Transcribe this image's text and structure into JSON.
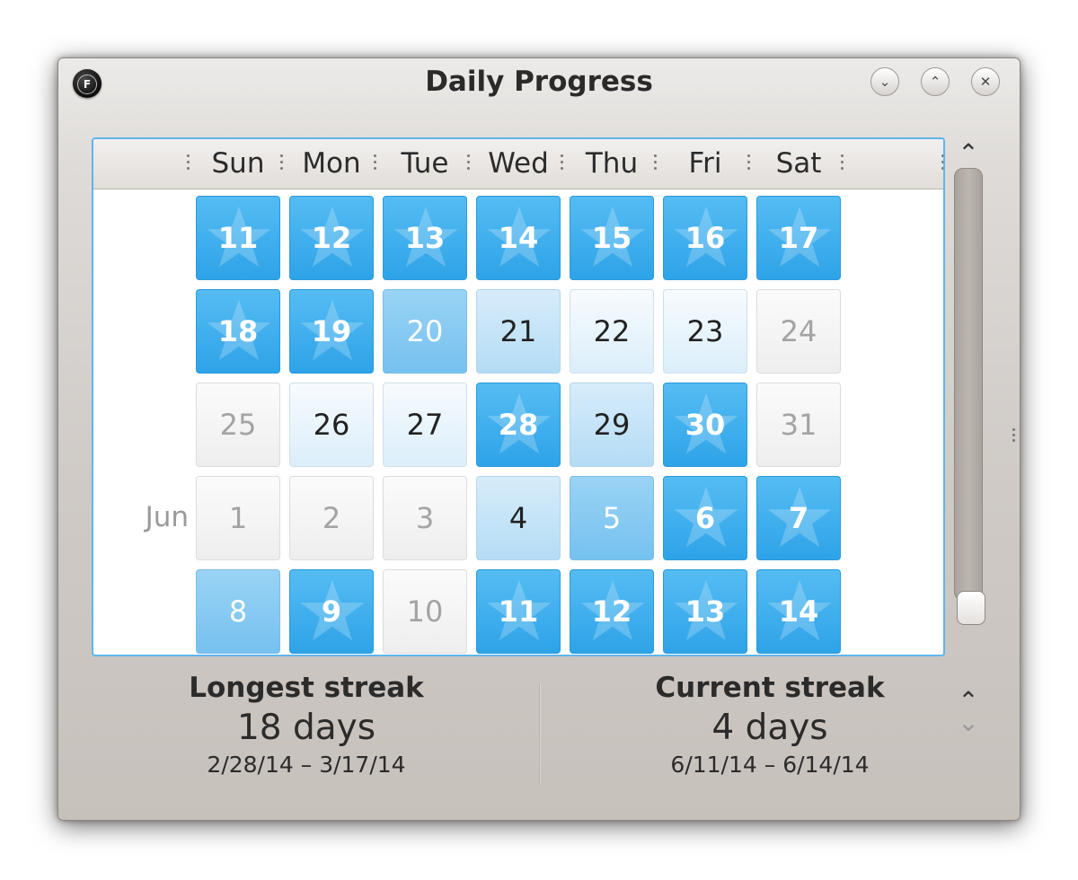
{
  "window": {
    "title": "Daily Progress",
    "app_icon_letter": "F"
  },
  "window_buttons": {
    "minimize": "⌄",
    "maximize": "⌃",
    "close": "✕"
  },
  "calendar": {
    "weekdays": [
      "Sun",
      "Mon",
      "Tue",
      "Wed",
      "Thu",
      "Fri",
      "Sat"
    ],
    "weeks": [
      {
        "month": "",
        "days": [
          {
            "d": "11",
            "level": 4
          },
          {
            "d": "12",
            "level": 4
          },
          {
            "d": "13",
            "level": 4
          },
          {
            "d": "14",
            "level": 4
          },
          {
            "d": "15",
            "level": 4
          },
          {
            "d": "16",
            "level": 4
          },
          {
            "d": "17",
            "level": 4
          }
        ]
      },
      {
        "month": "",
        "days": [
          {
            "d": "18",
            "level": 4
          },
          {
            "d": "19",
            "level": 4
          },
          {
            "d": "20",
            "level": 3
          },
          {
            "d": "21",
            "level": 2
          },
          {
            "d": "22",
            "level": 1
          },
          {
            "d": "23",
            "level": 1
          },
          {
            "d": "24",
            "level": 0
          }
        ]
      },
      {
        "month": "",
        "days": [
          {
            "d": "25",
            "level": 0
          },
          {
            "d": "26",
            "level": 1
          },
          {
            "d": "27",
            "level": 1
          },
          {
            "d": "28",
            "level": 4
          },
          {
            "d": "29",
            "level": 2
          },
          {
            "d": "30",
            "level": 4
          },
          {
            "d": "31",
            "level": 0
          }
        ]
      },
      {
        "month": "Jun",
        "days": [
          {
            "d": "1",
            "level": 0
          },
          {
            "d": "2",
            "level": 0
          },
          {
            "d": "3",
            "level": 0
          },
          {
            "d": "4",
            "level": 2
          },
          {
            "d": "5",
            "level": 3
          },
          {
            "d": "6",
            "level": 4
          },
          {
            "d": "7",
            "level": 4
          }
        ]
      },
      {
        "month": "",
        "days": [
          {
            "d": "8",
            "level": 3
          },
          {
            "d": "9",
            "level": 4
          },
          {
            "d": "10",
            "level": 0
          },
          {
            "d": "11",
            "level": 4
          },
          {
            "d": "12",
            "level": 4
          },
          {
            "d": "13",
            "level": 4
          },
          {
            "d": "14",
            "level": 4
          }
        ]
      }
    ]
  },
  "scrollbar": {
    "up_arrow": "⌃",
    "down_arrow": "⌄",
    "position": 0.98
  },
  "stats": {
    "longest": {
      "label": "Longest streak",
      "value": "18 days",
      "range": "2/28/14 – 3/17/14"
    },
    "current": {
      "label": "Current streak",
      "value": "4 days",
      "range": "6/11/14 – 6/14/14"
    }
  },
  "colors": {
    "done": "#2ea3e8",
    "partial": "#75c1ef",
    "light": "#b4dcf5",
    "faint": "#dbeefa",
    "empty": "#eeeeee",
    "focus_border": "#5fb6ea"
  }
}
